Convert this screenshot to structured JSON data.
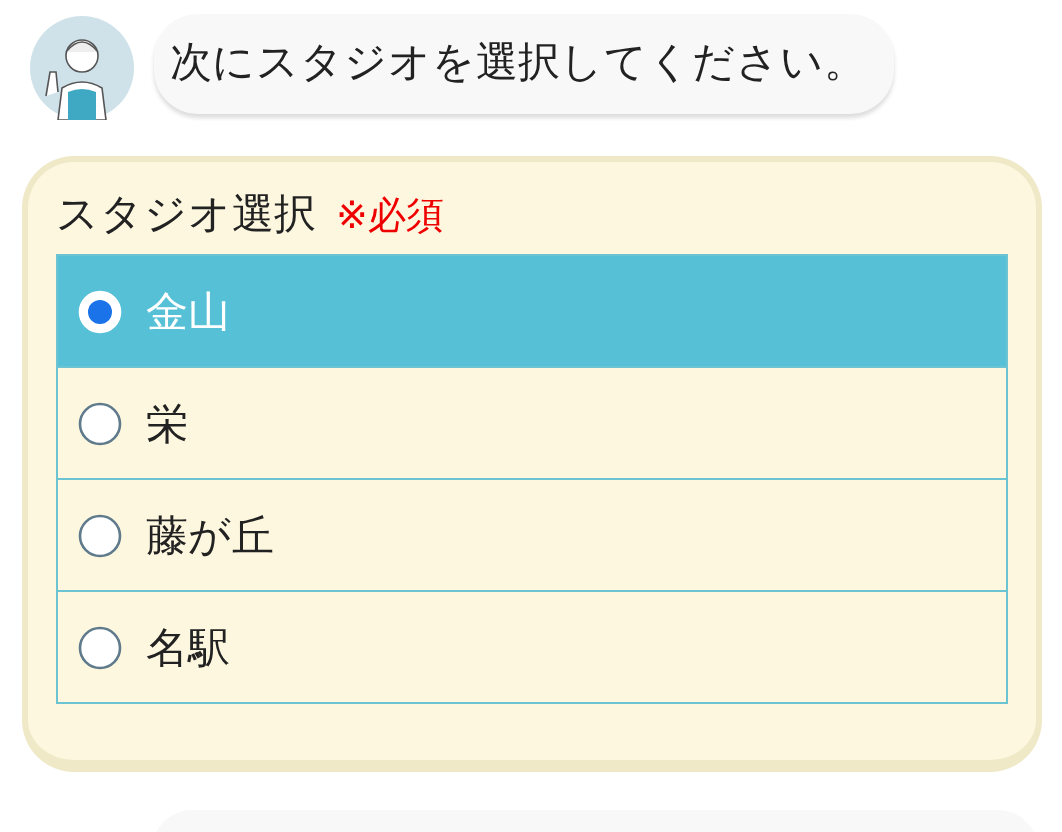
{
  "message": {
    "text": "次にスタジオを選択してください。"
  },
  "form": {
    "label": "スタジオ選択",
    "required": "※必須",
    "options": [
      {
        "label": "金山",
        "selected": true
      },
      {
        "label": "栄",
        "selected": false
      },
      {
        "label": "藤が丘",
        "selected": false
      },
      {
        "label": "名駅",
        "selected": false
      }
    ]
  }
}
